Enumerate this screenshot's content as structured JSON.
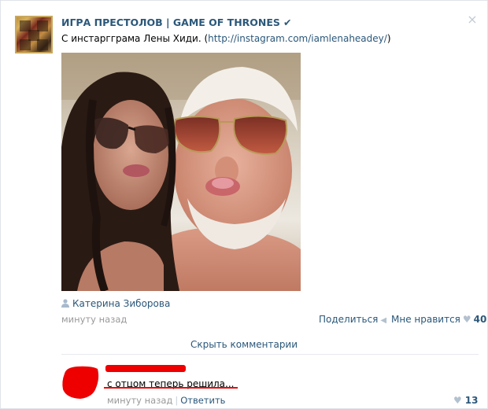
{
  "post": {
    "group_name": "ИГРА ПРЕСТОЛОВ | GAME OF THRONES",
    "verified_icon": "checkmark-icon",
    "text_prefix": "С инстаргграма Лены Хиди. (",
    "link": "http://instagram.com/iamlenaheadey/",
    "text_suffix": ")",
    "close_icon": "×",
    "author": "Катерина Зиборова",
    "time": "минуту назад",
    "share_label": "Поделиться",
    "like_label": "Мне нравится",
    "like_count": "40"
  },
  "comments": {
    "hide_label": "Скрыть комментарии",
    "items": [
      {
        "text": "с отцом теперь решила...",
        "time": "минуту назад",
        "separator": "|",
        "reply_label": "Ответить",
        "like_count": "13"
      }
    ]
  },
  "colors": {
    "link": "#2b587a",
    "meta": "#999999",
    "redaction": "#ee0000"
  }
}
